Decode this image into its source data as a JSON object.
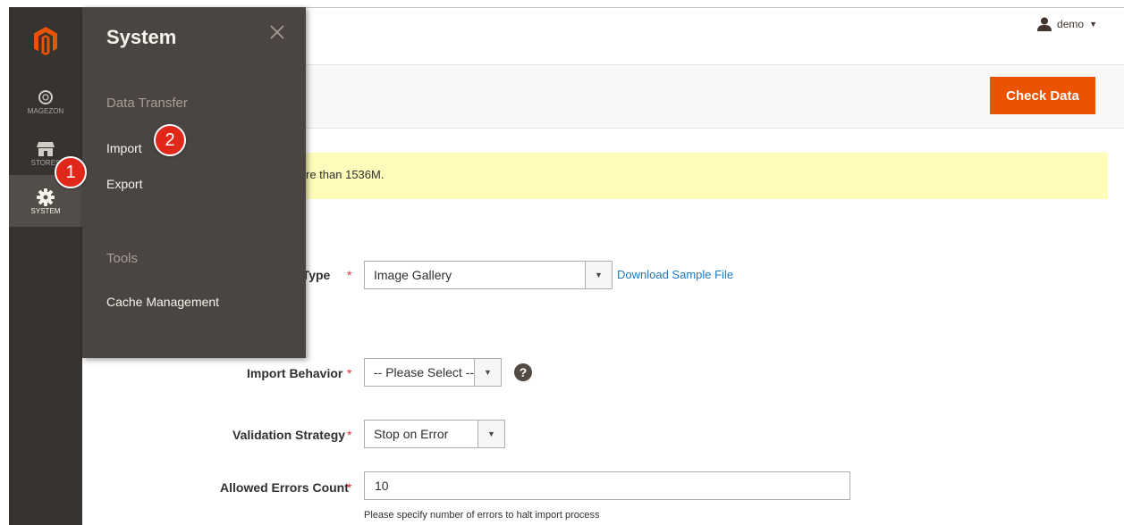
{
  "nav": {
    "items": [
      {
        "label": "MAGEZON",
        "icon": "magezon-icon"
      },
      {
        "label": "STORES",
        "icon": "store-icon"
      },
      {
        "label": "SYSTEM",
        "icon": "gear-icon"
      }
    ]
  },
  "flyout": {
    "title": "System",
    "section_data_transfer": "Data Transfer",
    "link_import": "Import",
    "link_export": "Export",
    "section_tools": "Tools",
    "link_cache": "Cache Management"
  },
  "badges": {
    "one": "1",
    "two": "2"
  },
  "header": {
    "user_name": "demo",
    "check_data_label": "Check Data"
  },
  "notice": {
    "text": "re than 1536M."
  },
  "form": {
    "entity_type_label": "y Type",
    "entity_type_value": "Image Gallery",
    "download_sample": "Download Sample File",
    "import_behavior_label": "Import Behavior",
    "import_behavior_value": "-- Please Select --",
    "validation_label": "Validation Strategy",
    "validation_value": "Stop on Error",
    "allowed_errors_label": "Allowed Errors Count",
    "allowed_errors_value": "10",
    "allowed_errors_note": "Please specify number of errors to halt import process",
    "required_mark": "*",
    "help_mark": "?"
  },
  "colors": {
    "accent": "#eb5202",
    "nav_bg": "#373330",
    "flyout_bg": "#4a4542",
    "badge": "#e0271a",
    "link": "#1979c3",
    "notice_bg": "#fffbbb"
  }
}
